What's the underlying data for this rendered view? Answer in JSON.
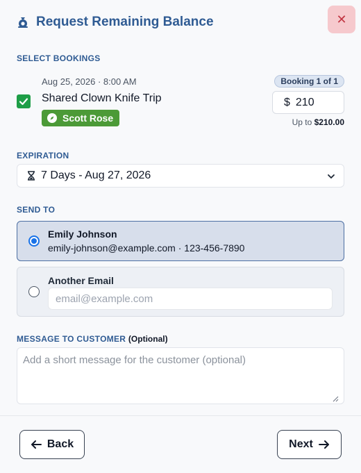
{
  "header": {
    "title": "Request Remaining Balance",
    "close_label": "✕"
  },
  "bookings_section": {
    "label": "SELECT BOOKINGS",
    "booking": {
      "date": "Aug 25, 2026 · 8:00 AM",
      "name": "Shared Clown Knife Trip",
      "guide": "Scott Rose",
      "count_badge": "Booking 1 of 1",
      "currency": "$",
      "amount": "210",
      "up_to_prefix": "Up to ",
      "up_to_amount": "$210.00",
      "checked": true
    }
  },
  "expiration_section": {
    "label": "EXPIRATION",
    "selected": "7 Days - Aug 27, 2026"
  },
  "send_to_section": {
    "label": "SEND TO",
    "contact": {
      "name": "Emily Johnson",
      "info": "emily-johnson@example.com · 123-456-7890"
    },
    "other": {
      "title": "Another Email",
      "placeholder": "email@example.com"
    }
  },
  "message_section": {
    "label": "MESSAGE TO CUSTOMER",
    "optional": "(Optional)",
    "placeholder": "Add a short message for the customer (optional)"
  },
  "footer": {
    "back_label": "Back",
    "next_label": "Next"
  },
  "colors": {
    "accent": "#2f5b93",
    "check": "#1e9e47",
    "guide_badge": "#4c9a37",
    "close_bg": "#f6c9cd"
  }
}
